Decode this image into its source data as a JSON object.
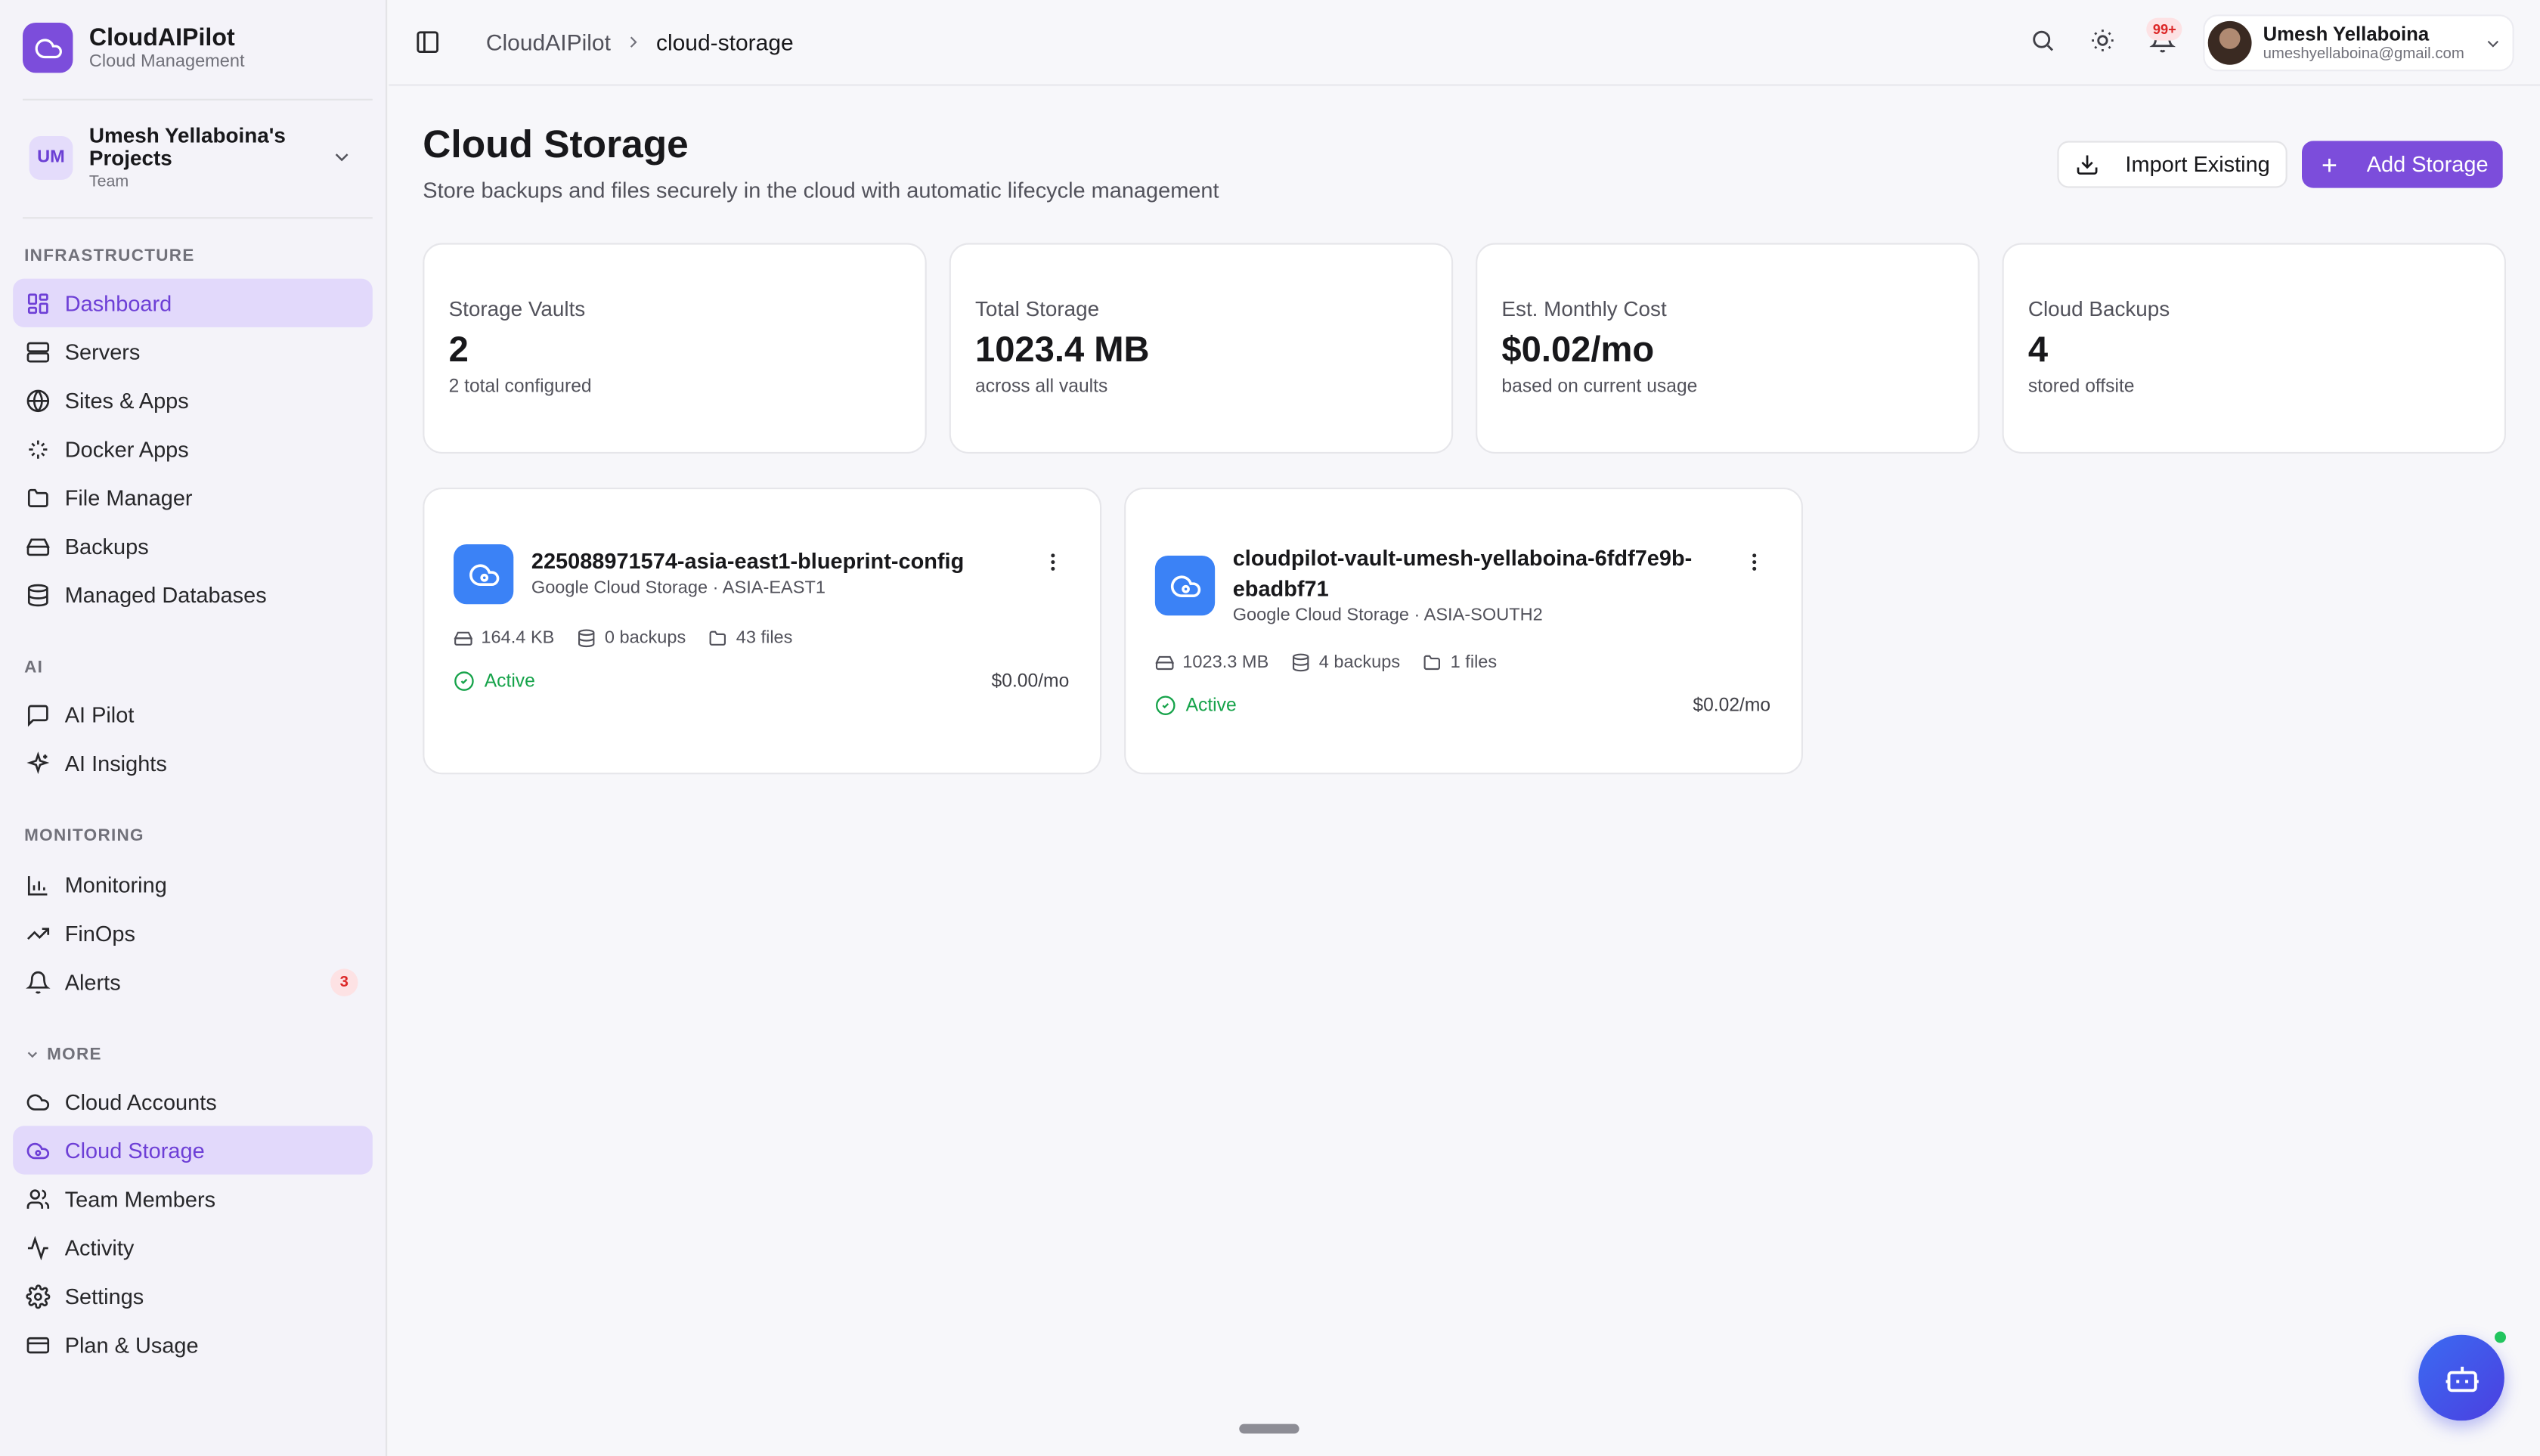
{
  "brand": {
    "name": "CloudAIPilot",
    "subtitle": "Cloud Management"
  },
  "project": {
    "initials": "UM",
    "name": "Umesh Yellaboina's Projects",
    "type": "Team"
  },
  "sidebar": {
    "infrastructure_label": "INFRASTRUCTURE",
    "infrastructure": [
      {
        "label": "Dashboard",
        "icon": "dashboard-icon",
        "active": true
      },
      {
        "label": "Servers",
        "icon": "server-icon"
      },
      {
        "label": "Sites & Apps",
        "icon": "globe-icon"
      },
      {
        "label": "Docker Apps",
        "icon": "docker-icon"
      },
      {
        "label": "File Manager",
        "icon": "folder-icon"
      },
      {
        "label": "Backups",
        "icon": "harddrive-icon"
      },
      {
        "label": "Managed Databases",
        "icon": "database-icon"
      }
    ],
    "ai_label": "AI",
    "ai": [
      {
        "label": "AI Pilot",
        "icon": "chat-icon"
      },
      {
        "label": "AI Insights",
        "icon": "sparkles-icon"
      }
    ],
    "monitoring_label": "MONITORING",
    "monitoring": [
      {
        "label": "Monitoring",
        "icon": "bar-chart-icon"
      },
      {
        "label": "FinOps",
        "icon": "trend-icon"
      },
      {
        "label": "Alerts",
        "icon": "bell-icon",
        "badge": "3"
      }
    ],
    "more_label": "MORE",
    "more": [
      {
        "label": "Cloud Accounts",
        "icon": "cloud-icon"
      },
      {
        "label": "Cloud Storage",
        "icon": "cloud-storage-icon",
        "active": true
      },
      {
        "label": "Team Members",
        "icon": "users-icon"
      },
      {
        "label": "Activity",
        "icon": "activity-icon"
      },
      {
        "label": "Settings",
        "icon": "gear-icon"
      },
      {
        "label": "Plan & Usage",
        "icon": "credit-card-icon"
      }
    ]
  },
  "topbar": {
    "breadcrumb": [
      "CloudAIPilot",
      "cloud-storage"
    ],
    "notification_badge": "99+",
    "user_name": "Umesh Yellaboina",
    "user_email": "umeshyellaboina@gmail.com"
  },
  "page": {
    "title": "Cloud Storage",
    "subtitle": "Store backups and files securely in the cloud with automatic lifecycle management",
    "import_label": "Import Existing",
    "add_label": "Add Storage"
  },
  "stats": [
    {
      "label": "Storage Vaults",
      "value": "2",
      "sub": "2 total configured"
    },
    {
      "label": "Total Storage",
      "value": "1023.4 MB",
      "sub": "across all vaults"
    },
    {
      "label": "Est. Monthly Cost",
      "value": "$0.02/mo",
      "sub": "based on current usage"
    },
    {
      "label": "Cloud Backups",
      "value": "4",
      "sub": "stored offsite"
    }
  ],
  "vaults": [
    {
      "name": "225088971574-asia-east1-blueprint-config",
      "provider": "Google Cloud Storage · ASIA-EAST1",
      "size": "164.4 KB",
      "backups": "0 backups",
      "files": "43 files",
      "status": "Active",
      "cost": "$0.00/mo"
    },
    {
      "name": "cloudpilot-vault-umesh-yellaboina-6fdf7e9b-ebadbf71",
      "provider": "Google Cloud Storage · ASIA-SOUTH2",
      "size": "1023.3 MB",
      "backups": "4 backups",
      "files": "1 files",
      "status": "Active",
      "cost": "$0.02/mo"
    }
  ],
  "colors": {
    "accent": "#7c4ddb",
    "active_bg": "#e2d9fb",
    "vault_icon": "#3b82f6",
    "status_active": "#16a34a"
  }
}
